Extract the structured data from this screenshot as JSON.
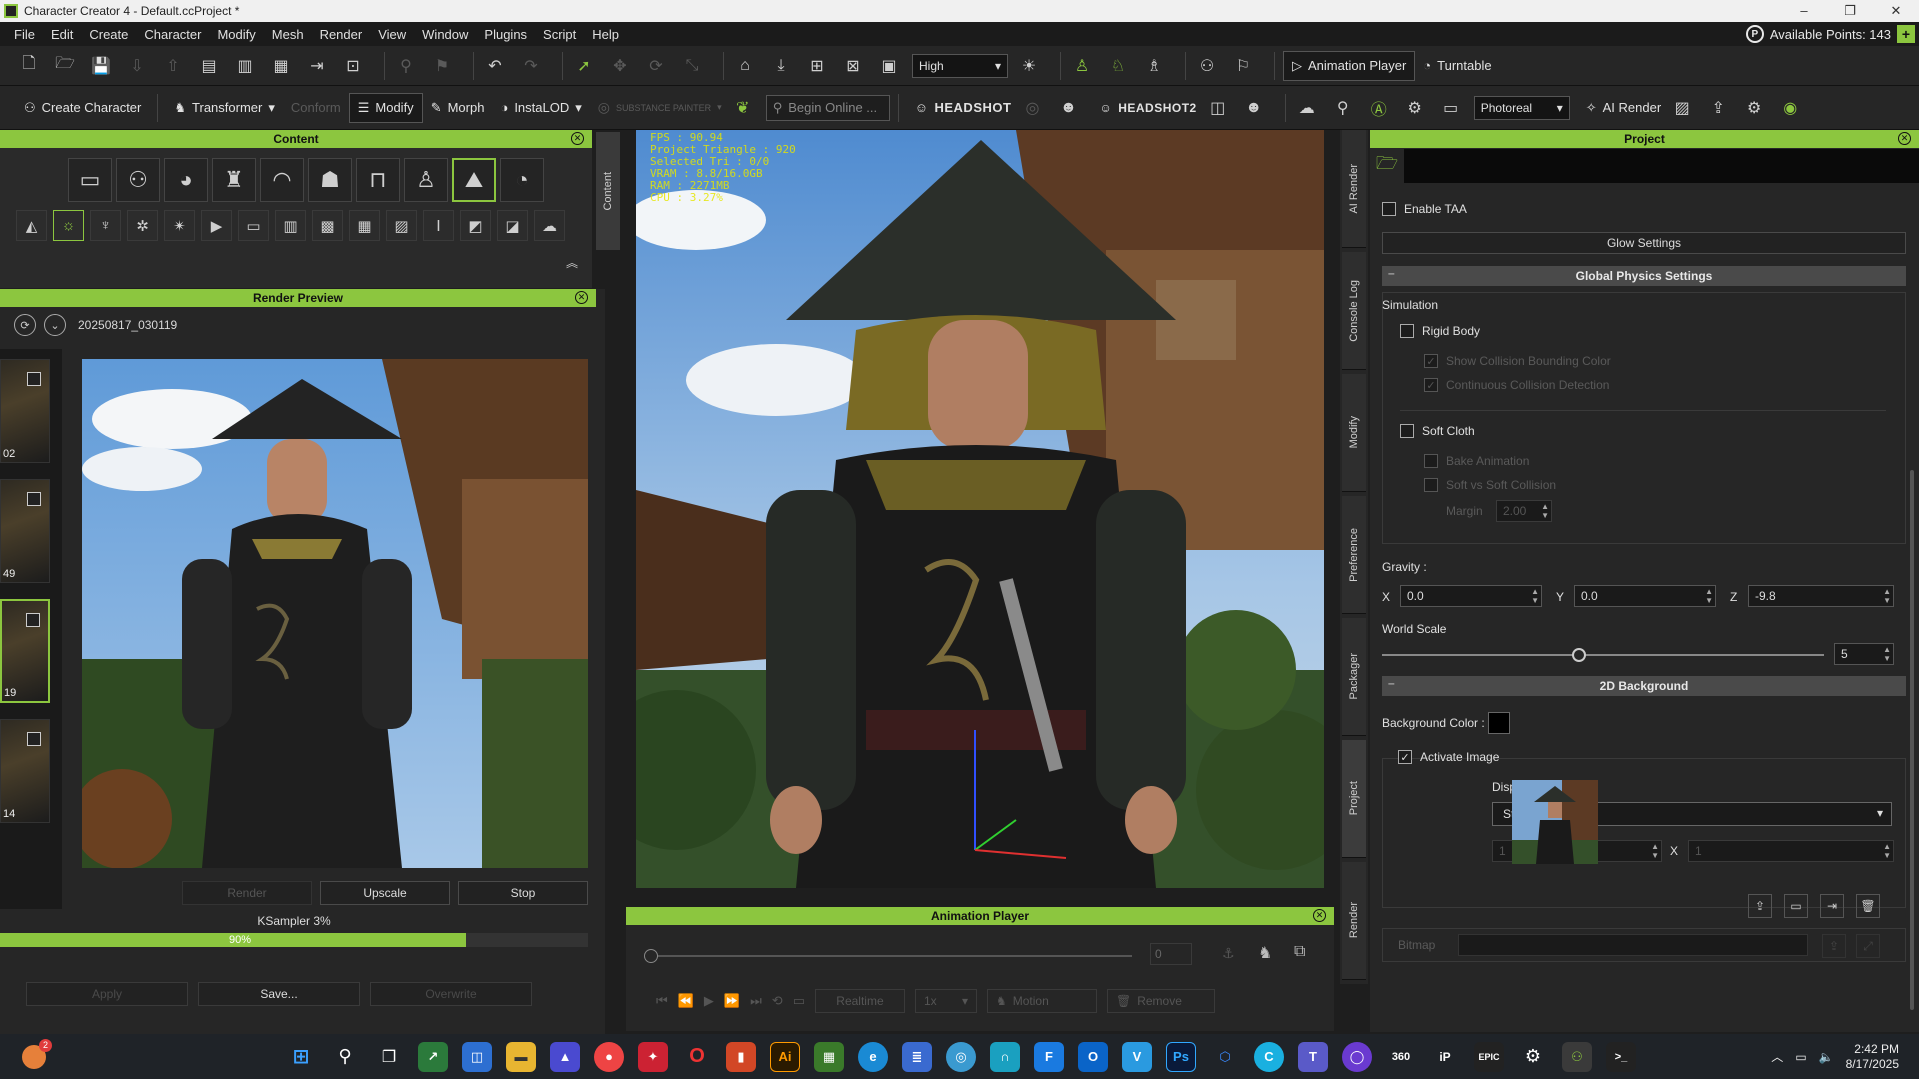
{
  "window": {
    "title": "Character Creator 4 - Default.ccProject *"
  },
  "menu": [
    "File",
    "Edit",
    "Create",
    "Character",
    "Modify",
    "Mesh",
    "Render",
    "View",
    "Window",
    "Plugins",
    "Script",
    "Help"
  ],
  "points": {
    "label": "Available Points: 143"
  },
  "toolbar1": {
    "quality": "High",
    "animation_player": "Animation Player",
    "turntable": "Turntable"
  },
  "toolbar2": {
    "create_character": "Create Character",
    "transformer": "Transformer",
    "conform": "Conform",
    "modify": "Modify",
    "morph": "Morph",
    "instalod": "InstaLOD",
    "substance": "SUBSTANCE PAINTER",
    "search_placeholder": "Begin Online ...",
    "headshot": "HEADSHOT",
    "headshot2": "HEADSHOT2",
    "render_mode": "Photoreal",
    "ai_render": "AI Render"
  },
  "content_panel": {
    "title": "Content",
    "side_tab": "Content"
  },
  "render_preview": {
    "title": "Render Preview",
    "timestamp": "20250817_030119",
    "thumbnails": [
      {
        "num": "02",
        "selected": false
      },
      {
        "num": "49",
        "selected": false
      },
      {
        "num": "19",
        "selected": true
      },
      {
        "num": "14",
        "selected": false
      }
    ],
    "buttons": {
      "render": "Render",
      "upscale": "Upscale",
      "stop": "Stop"
    },
    "status": "KSampler 3%",
    "progress": {
      "percent_label": "90%",
      "value": 0.9
    },
    "actions": {
      "apply": "Apply",
      "save": "Save...",
      "overwrite": "Overwrite"
    }
  },
  "viewport_hud": {
    "fps": "FPS : 90.94",
    "triangle": "Project Triangle : 920",
    "selected": "Selected Tri : 0/0",
    "vram": "VRAM : 8.8/16.0GB",
    "ram": "RAM : 2271MB",
    "cpu": "CPU : 3.27%"
  },
  "animation_player": {
    "title": "Animation Player",
    "frame": "0",
    "realtime": "Realtime",
    "speed": "1x",
    "motion": "Motion",
    "remove": "Remove"
  },
  "vertical_tabs": [
    "AI Render",
    "Console Log",
    "Modify",
    "Preference",
    "Packager",
    "Project",
    "Render"
  ],
  "project_panel": {
    "title": "Project",
    "enable_taa": "Enable TAA",
    "glow_settings": "Glow Settings",
    "global_physics": "Global Physics Settings",
    "simulation": "Simulation",
    "rigid_body": "Rigid Body",
    "show_collision": "Show Collision Bounding Color",
    "continuous_collision": "Continuous Collision Detection",
    "soft_cloth": "Soft Cloth",
    "bake_animation": "Bake Animation",
    "soft_vs_soft": "Soft vs Soft Collision",
    "margin_label": "Margin",
    "margin_value": "2.00",
    "gravity": "Gravity :",
    "gx_label": "X",
    "gx": "0.0",
    "gy_label": "Y",
    "gy": "0.0",
    "gz_label": "Z",
    "gz": "-9.8",
    "world_scale": "World Scale",
    "world_scale_value": "5",
    "background_2d": "2D Background",
    "background_color": "Background Color :",
    "activate_image": "Activate Image",
    "display_mode_label": "Display Mode :",
    "display_mode": "Stretch",
    "dim_w": "1",
    "dim_x": "X",
    "dim_h": "1",
    "bitmap": "Bitmap"
  },
  "taskbar": {
    "notification_count": "2",
    "time": "2:42 PM",
    "date": "8/17/2025"
  }
}
